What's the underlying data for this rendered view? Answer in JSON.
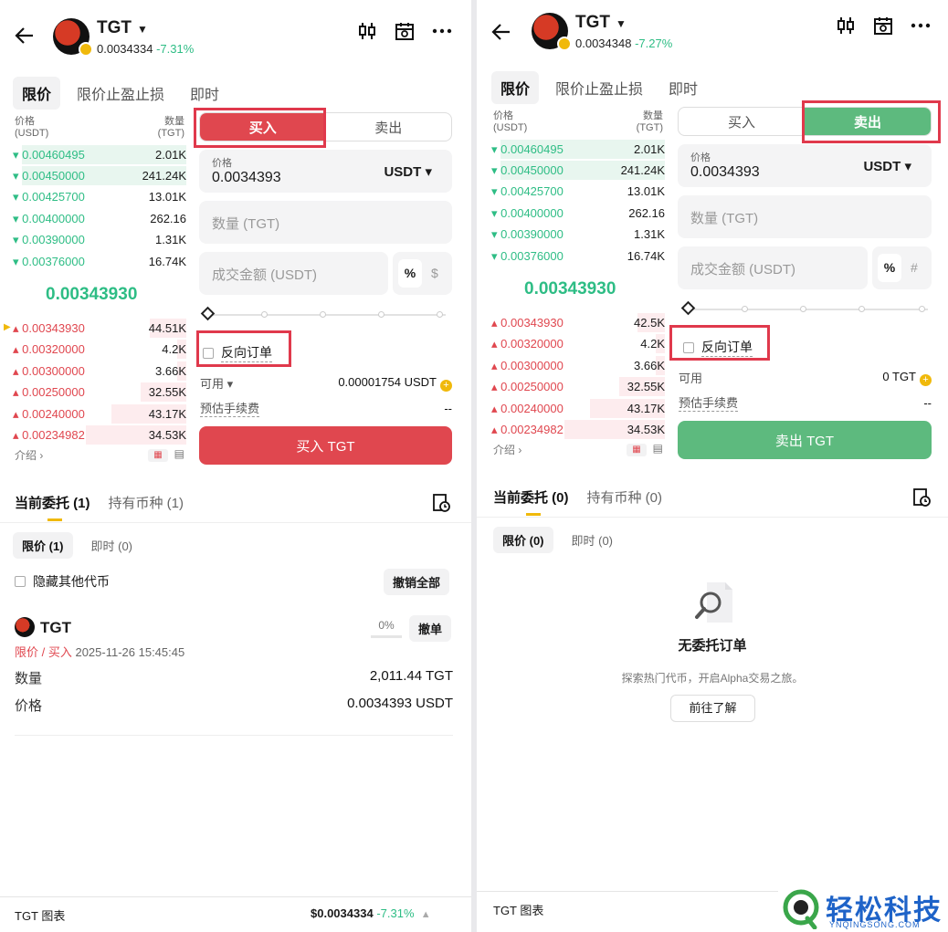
{
  "left": {
    "header": {
      "symbol": "TGT",
      "price": "0.0034334",
      "change": "-7.31%"
    },
    "order_types": [
      "限价",
      "限价止盈止损",
      "即时"
    ],
    "orderbook": {
      "col_price": "价格",
      "col_price_unit": "(USDT)",
      "col_qty": "数量",
      "col_qty_unit": "(TGT)",
      "asks": [
        {
          "price": "0.00460495",
          "qty": "2.01K"
        },
        {
          "price": "0.00450000",
          "qty": "241.24K"
        },
        {
          "price": "0.00425700",
          "qty": "13.01K"
        },
        {
          "price": "0.00400000",
          "qty": "262.16"
        },
        {
          "price": "0.00390000",
          "qty": "1.31K"
        },
        {
          "price": "0.00376000",
          "qty": "16.74K"
        }
      ],
      "mid": "0.00343930",
      "bids": [
        {
          "price": "0.00343930",
          "qty": "44.51K"
        },
        {
          "price": "0.00320000",
          "qty": "4.2K"
        },
        {
          "price": "0.00300000",
          "qty": "3.66K"
        },
        {
          "price": "0.00250000",
          "qty": "32.55K"
        },
        {
          "price": "0.00240000",
          "qty": "43.17K"
        },
        {
          "price": "0.00234982",
          "qty": "34.53K"
        }
      ],
      "intro": "介绍 ›"
    },
    "form": {
      "buy": "买入",
      "sell": "卖出",
      "price_label": "价格",
      "price_value": "0.0034393",
      "price_unit": "USDT ▾",
      "qty_ph": "数量 (TGT)",
      "amount_ph": "成交金额 (USDT)",
      "pct": "%",
      "alt_unit": "$",
      "reverse": "反向订单",
      "avail_label": "可用 ▾",
      "avail_value": "0.00001754 USDT",
      "fee_label": "预估手续费",
      "fee_value": "--",
      "submit": "买入 TGT"
    },
    "orders": {
      "tab_open": "当前委托 (1)",
      "tab_hold": "持有币种 (1)",
      "sub_limit": "限价 (1)",
      "sub_instant": "即时 (0)",
      "hide_other": "隐藏其他代币",
      "cancel_all": "撤销全部",
      "item": {
        "symbol": "TGT",
        "progress": "0%",
        "progress_value": 0,
        "cancel": "撤单",
        "type": "限价 / 买入",
        "time": "2025-11-26 15:45:45",
        "qty_label": "数量",
        "qty_value": "2,011.44 TGT",
        "price_label": "价格",
        "price_value": "0.0034393 USDT"
      }
    },
    "bottom": {
      "chart": "TGT 图表",
      "price": "$0.0034334",
      "change": "-7.31%",
      "arrow": "▲"
    }
  },
  "right": {
    "header": {
      "symbol": "TGT",
      "price": "0.0034348",
      "change": "-7.27%"
    },
    "order_types": [
      "限价",
      "限价止盈止损",
      "即时"
    ],
    "orderbook": {
      "col_price": "价格",
      "col_price_unit": "(USDT)",
      "col_qty": "数量",
      "col_qty_unit": "(TGT)",
      "asks": [
        {
          "price": "0.00460495",
          "qty": "2.01K"
        },
        {
          "price": "0.00450000",
          "qty": "241.24K"
        },
        {
          "price": "0.00425700",
          "qty": "13.01K"
        },
        {
          "price": "0.00400000",
          "qty": "262.16"
        },
        {
          "price": "0.00390000",
          "qty": "1.31K"
        },
        {
          "price": "0.00376000",
          "qty": "16.74K"
        }
      ],
      "mid": "0.00343930",
      "bids": [
        {
          "price": "0.00343930",
          "qty": "42.5K"
        },
        {
          "price": "0.00320000",
          "qty": "4.2K"
        },
        {
          "price": "0.00300000",
          "qty": "3.66K"
        },
        {
          "price": "0.00250000",
          "qty": "32.55K"
        },
        {
          "price": "0.00240000",
          "qty": "43.17K"
        },
        {
          "price": "0.00234982",
          "qty": "34.53K"
        }
      ],
      "intro": "介绍 ›"
    },
    "form": {
      "buy": "买入",
      "sell": "卖出",
      "price_label": "价格",
      "price_value": "0.0034393",
      "price_unit": "USDT ▾",
      "qty_ph": "数量 (TGT)",
      "amount_ph": "成交金额 (USDT)",
      "pct": "%",
      "alt_unit": "#",
      "reverse": "反向订单",
      "avail_label": "可用",
      "avail_value": "0 TGT",
      "fee_label": "预估手续费",
      "fee_value": "--",
      "submit": "卖出 TGT"
    },
    "orders": {
      "tab_open": "当前委托 (0)",
      "tab_hold": "持有币种 (0)",
      "sub_limit": "限价 (0)",
      "sub_instant": "即时 (0)",
      "empty_title": "无委托订单",
      "empty_desc": "探索热门代币，开启Alpha交易之旅。",
      "empty_btn": "前往了解"
    },
    "bottom": {
      "chart": "TGT 图表"
    }
  },
  "watermark": {
    "brand": "轻松科技",
    "url": "YNQINGSONG.COM"
  },
  "colors": {
    "green": "#2ebd85",
    "red": "#e0474f",
    "sell_green": "#5dba7e",
    "highlight": "#e0394c",
    "yellow": "#f0b90b"
  }
}
